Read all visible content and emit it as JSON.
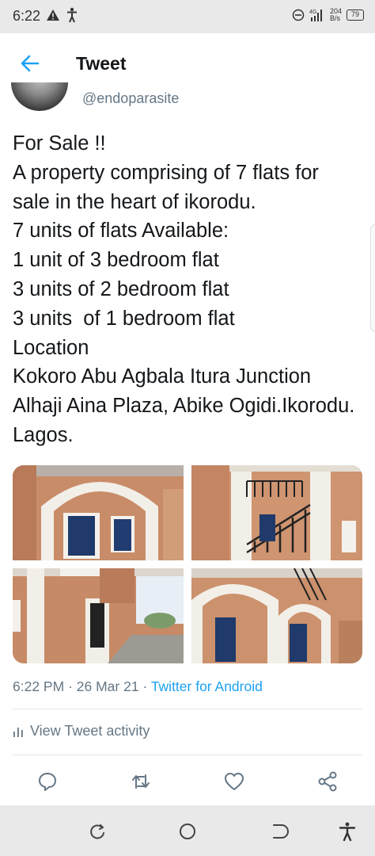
{
  "status_bar": {
    "time": "6:22",
    "network": "4G",
    "speed_value": "204",
    "speed_unit": "B/s",
    "battery": "79"
  },
  "app_bar": {
    "title": "Tweet"
  },
  "tweet": {
    "handle": "@endoparasite",
    "text": "For Sale !!\nA property comprising of 7 flats for sale in the heart of ikorodu.\n7 units of flats Available:\n1 unit of 3 bedroom flat\n3 units of 2 bedroom flat\n3 units  of 1 bedroom flat\nLocation\nKokoro Abu Agbala Itura Junction Alhaji Aina Plaza, Abike Ogidi.Ikorodu. Lagos.",
    "time": "6:22 PM",
    "separator": "·",
    "date": "26 Mar 21",
    "source": "Twitter for Android"
  },
  "activity": {
    "label": "View Tweet activity"
  },
  "actions": [
    "reply-icon",
    "retweet-icon",
    "like-icon",
    "share-icon"
  ],
  "nav": [
    "recents-icon",
    "home-icon",
    "back-icon",
    "accessibility-icon"
  ],
  "colors": {
    "accent": "#1da1f2",
    "secondary_text": "#657786",
    "primary_text": "#14171a"
  }
}
